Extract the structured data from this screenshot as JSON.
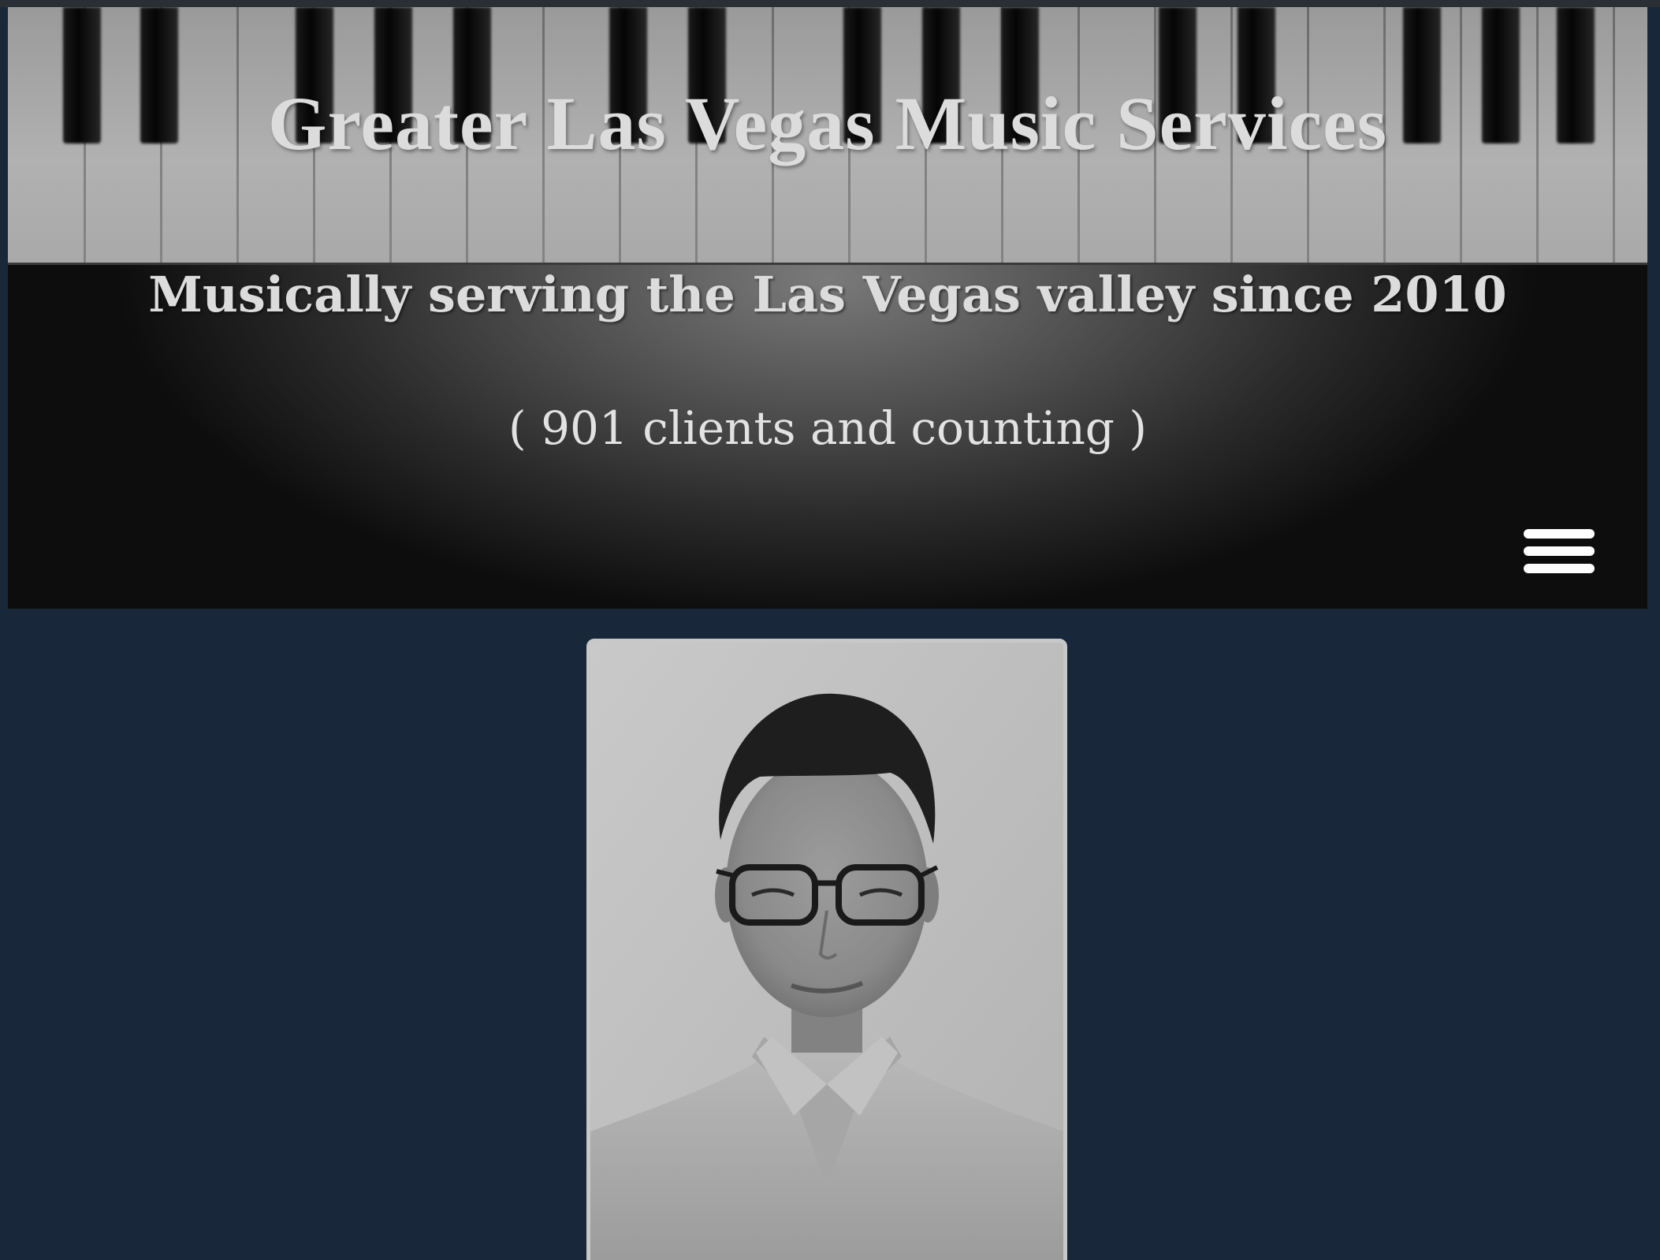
{
  "header": {
    "site_title": "Greater Las Vegas Music Services",
    "tagline": "Musically serving the Las Vegas valley since 2010",
    "client_count": "( 901 clients and counting )",
    "menu_icon": "hamburger-menu-icon"
  },
  "main": {
    "portrait": "headshot-photo"
  },
  "colors": {
    "page_background": "#18283a",
    "header_text": "#dcdcdc",
    "menu_icon": "#ffffff"
  }
}
